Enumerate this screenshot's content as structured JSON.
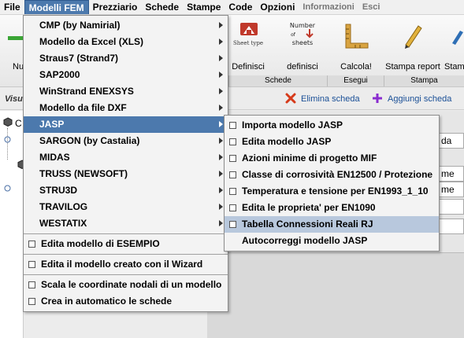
{
  "menubar": {
    "items": [
      "File",
      "Modelli FEM",
      "Prezziario",
      "Schede",
      "Stampe",
      "Code",
      "Opzioni",
      "Informazioni",
      "Esci"
    ]
  },
  "toolbar": {
    "first_label": "Nu",
    "buttons": [
      {
        "label": "Definisci",
        "icon": "sheet-type-icon",
        "icon_text": "Sheet type"
      },
      {
        "label": "definisci",
        "icon": "number-of-sheets-icon",
        "icon_text_1": "Number",
        "icon_text_2": "of",
        "icon_text_3": "sheets"
      },
      {
        "label": "Calcola!",
        "icon": "ruler-square-icon"
      },
      {
        "label": "Stampa report",
        "icon": "pencil-icon"
      },
      {
        "label": "Stam",
        "icon": "print-icon"
      }
    ],
    "groups": [
      "Schede",
      "Esegui",
      "Stampa"
    ]
  },
  "secbar": {
    "left_label": "Visu",
    "delete_label": "Elimina scheda",
    "add_label": "Aggiungi scheda"
  },
  "tree": {
    "first": "C"
  },
  "rightpanel": {
    "field1": "da",
    "field2": "me",
    "field3": "me"
  },
  "modelli_menu": {
    "items": [
      {
        "label": "CMP (by Namirial)",
        "submenu": true
      },
      {
        "label": "Modello da Excel (XLS)",
        "submenu": true
      },
      {
        "label": "Straus7 (Strand7)",
        "submenu": true
      },
      {
        "label": "SAP2000",
        "submenu": true
      },
      {
        "label": "WinStrand ENEXSYS",
        "submenu": true
      },
      {
        "label": "Modello da file DXF",
        "submenu": true
      },
      {
        "label": "JASP",
        "submenu": true,
        "selected": true
      },
      {
        "label": "SARGON (by Castalia)",
        "submenu": true
      },
      {
        "label": "MIDAS",
        "submenu": true
      },
      {
        "label": "TRUSS (NEWSOFT)",
        "submenu": true
      },
      {
        "label": "STRU3D",
        "submenu": true
      },
      {
        "label": "TRAVILOG",
        "submenu": true
      },
      {
        "label": "WESTATIX",
        "submenu": true
      }
    ],
    "extra_group_1": [
      "Edita modello di ESEMPIO"
    ],
    "extra_group_2": [
      "Edita il modello creato con il Wizard"
    ],
    "extra_group_3": [
      "Scala le coordinate nodali di un modello",
      "Crea in automatico le schede"
    ]
  },
  "jasp_menu": {
    "items": [
      {
        "label": "Importa modello JASP"
      },
      {
        "label": "Edita modello JASP"
      },
      {
        "label": "Azioni minime di progetto MIF"
      },
      {
        "label": "Classe di corrosività EN12500 / Protezione"
      },
      {
        "label": "Temperatura e tensione per EN1993_1_10"
      },
      {
        "label": "Edita le proprieta' per EN1090"
      },
      {
        "label": "Tabella Connessioni Reali RJ",
        "highlight": true
      },
      {
        "label": "Autocorreggi modello JASP",
        "nocheck": true
      }
    ]
  },
  "colors": {
    "menu_selected": "#4c79ad",
    "menu_hover": "#b8c8dd",
    "delete_icon": "#d63a1a",
    "add_icon": "#8a2ccf"
  }
}
